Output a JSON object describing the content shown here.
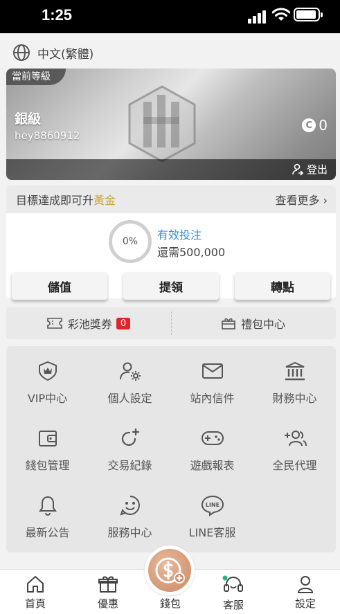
{
  "status_bar": {
    "time": "1:25"
  },
  "language": {
    "label": "中文(繁體)"
  },
  "profile": {
    "tag": "當前等級",
    "level": "銀級",
    "username": "hey8860912",
    "coin_symbol": "C",
    "coins": "0",
    "logout_label": "登出"
  },
  "target": {
    "prefix": "目標達成即可升",
    "next_level": "黃金",
    "see_more": "查看更多 ›",
    "progress_text": "0%",
    "progress": 0,
    "bet_label": "有效投注",
    "remaining": "還需500,000"
  },
  "actions": {
    "deposit": "儲值",
    "withdraw": "提領",
    "transfer": "轉點"
  },
  "promo": {
    "jackpot_label": "彩池獎券",
    "jackpot_count": "0",
    "gift_label": "禮包中心"
  },
  "menu": [
    {
      "label": "VIP中心",
      "icon": "vip-crown-icon"
    },
    {
      "label": "個人設定",
      "icon": "user-settings-icon"
    },
    {
      "label": "站內信件",
      "icon": "mail-icon"
    },
    {
      "label": "財務中心",
      "icon": "bank-icon"
    },
    {
      "label": "錢包管理",
      "icon": "wallet-icon"
    },
    {
      "label": "交易紀錄",
      "icon": "refresh-plus-icon"
    },
    {
      "label": "遊戲報表",
      "icon": "gamepad-icon"
    },
    {
      "label": "全民代理",
      "icon": "add-users-icon"
    },
    {
      "label": "最新公告",
      "icon": "bell-icon"
    },
    {
      "label": "服務中心",
      "icon": "smile-chat-icon"
    },
    {
      "label": "LINE客服",
      "icon": "line-icon"
    }
  ],
  "line_icon_text": "LINE",
  "tabs": {
    "home": "首頁",
    "promotions": "優惠",
    "wallet": "錢包",
    "support": "客服",
    "settings": "設定"
  },
  "colors": {
    "gold": "#c9a23a",
    "bet_blue": "#3a8fd0",
    "badge_red": "#e0242b",
    "wallet_fab": "#c98a66"
  }
}
